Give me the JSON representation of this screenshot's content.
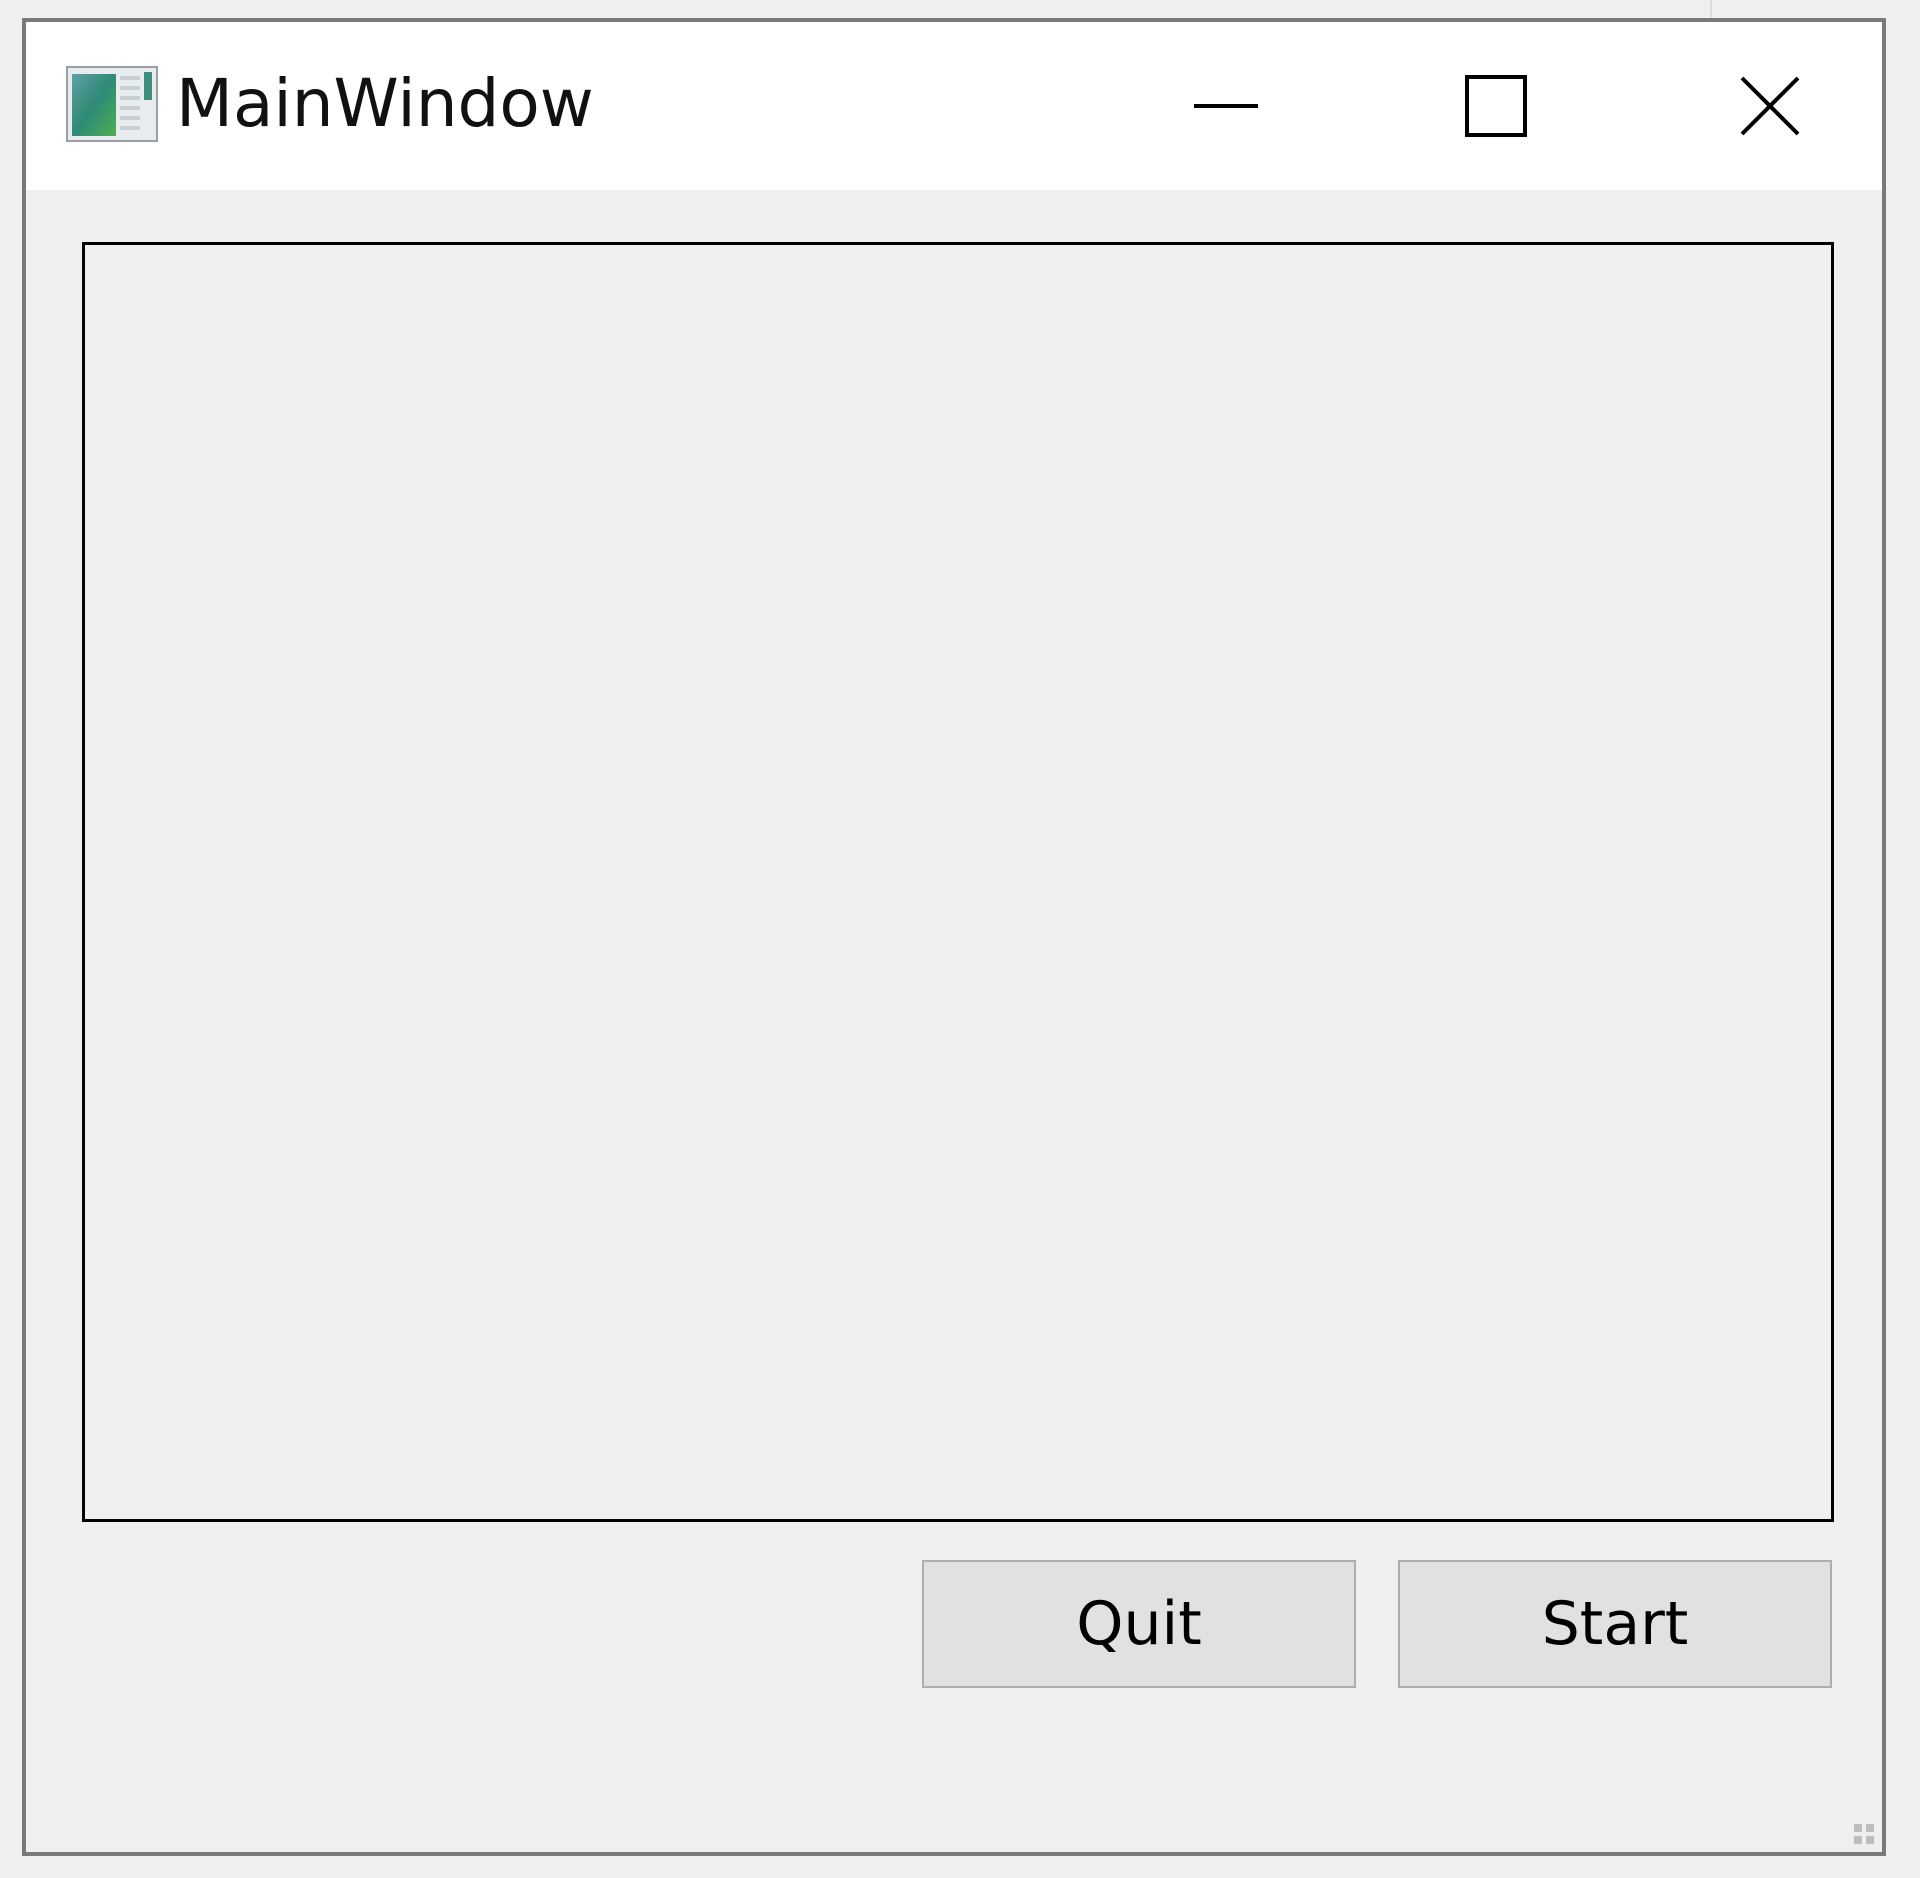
{
  "window": {
    "title": "MainWindow",
    "icon": "app-window-icon",
    "controls": {
      "minimize": "minimize-icon",
      "maximize": "maximize-icon",
      "close": "close-icon"
    }
  },
  "buttons": {
    "quit_label": "Quit",
    "start_label": "Start"
  },
  "colors": {
    "titlebar_bg": "#ffffff",
    "client_bg": "#efefef",
    "window_border": "#7a7a7a",
    "button_bg": "#e1e1e1",
    "button_border": "#adadad"
  }
}
